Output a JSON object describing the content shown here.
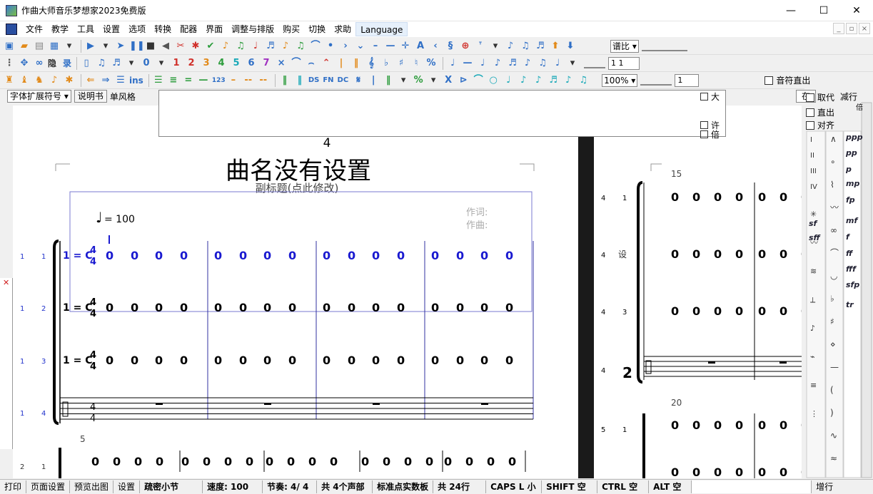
{
  "window": {
    "title": "作曲大师音乐梦想家2023免费版",
    "minimize": "—",
    "maximize": "☐",
    "close": "✕"
  },
  "menu": [
    "文件",
    "教学",
    "工具",
    "设置",
    "选项",
    "转换",
    "配器",
    "界面",
    "调整与排版",
    "购买",
    "切换",
    "求助",
    "Language"
  ],
  "toolbar": {
    "ratio_select": "谱比",
    "zoom_select": "100%",
    "spin1": "1 1",
    "spin2": "1",
    "text_labels": {
      "hide": "隐",
      "record": "录",
      "ins": "ins",
      "ds": "DS",
      "fn": "FN",
      "dc": "DC"
    },
    "note_out_label": "音符直出"
  },
  "options_row": {
    "font_select": "字体扩展符号",
    "manual_button": "说明书",
    "style_label": "单风格"
  },
  "popup": {
    "big": "大",
    "allow": "许",
    "double": "倍"
  },
  "side_panel": {
    "top_button": "在",
    "replace_label": "取代",
    "line_label": "减行",
    "direct_label": "直出",
    "align_label": "对齐",
    "double": "倍",
    "dynamics": [
      "ppp",
      "pp",
      "p",
      "mp",
      "fp",
      "sf",
      "mf",
      "sff",
      "f",
      "ff",
      "fff",
      "sfp",
      "tr"
    ],
    "roman": [
      "I",
      "II",
      "III",
      "IV"
    ]
  },
  "score": {
    "page_number": "4",
    "title": "曲名没有设置",
    "subtitle": "副标题(点此修改)",
    "tempo": "= 100",
    "lyricist": "作词:",
    "composer": "作曲:",
    "key": "1 = C",
    "time_top": "4",
    "time_bottom": "4",
    "note": "0",
    "rows": [
      {
        "a": "1",
        "b": "1"
      },
      {
        "a": "1",
        "b": "2"
      },
      {
        "a": "1",
        "b": "3"
      },
      {
        "a": "1",
        "b": "4"
      }
    ],
    "next_system_measure": "5",
    "next_system_label": {
      "a": "2",
      "b": "1"
    },
    "page2": {
      "measure_a": "15",
      "measure_b": "20",
      "row_labels": [
        {
          "a": "4",
          "b": "1"
        },
        {
          "a": "4",
          "b": "3"
        },
        {
          "a": "4",
          "b": ""
        },
        {
          "a": "5",
          "b": "1"
        }
      ],
      "set_label": "设"
    }
  },
  "status": {
    "print": "打印",
    "page_setup": "页面设置",
    "preview": "预览出图",
    "settings": "设置",
    "sparse": "疏密小节",
    "speed": "速度: 100",
    "beat": "节奏: 4/ 4",
    "voices": "共 4个声部",
    "panel": "标准点实数板",
    "rows": "共 24行",
    "caps": "CAPS L 小",
    "shift": "SHIFT 空",
    "ctrl": "CTRL 空",
    "alt": "ALT 空",
    "add_row": "增行"
  },
  "colors": {
    "note_blue": "#1a1ad0",
    "barline_blue": "#3030a0",
    "label_blue": "#2233cc"
  }
}
